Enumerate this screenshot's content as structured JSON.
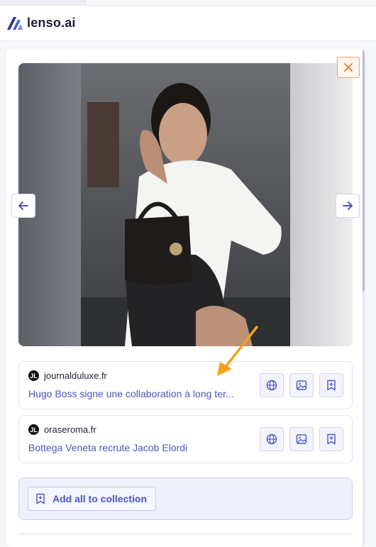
{
  "header": {
    "brand": "lenso.ai"
  },
  "viewer": {
    "close_icon": "close-icon",
    "prev_icon": "arrow-left-icon",
    "next_icon": "arrow-right-icon"
  },
  "results": [
    {
      "site": "journalduluxe.fr",
      "title": "Hugo Boss signe une collaboration à long ter..."
    },
    {
      "site": "oraseroma.fr",
      "title": "Bottega Veneta recrute Jacob Elordi"
    }
  ],
  "actions": {
    "web_icon": "globe-icon",
    "image_icon": "image-icon",
    "save_icon": "bookmark-plus-icon"
  },
  "collection": {
    "add_all_label": "Add all to collection"
  },
  "colors": {
    "accent": "#4a56c4",
    "close_accent": "#de7a2c",
    "annotation_arrow": "#f2a31b"
  }
}
